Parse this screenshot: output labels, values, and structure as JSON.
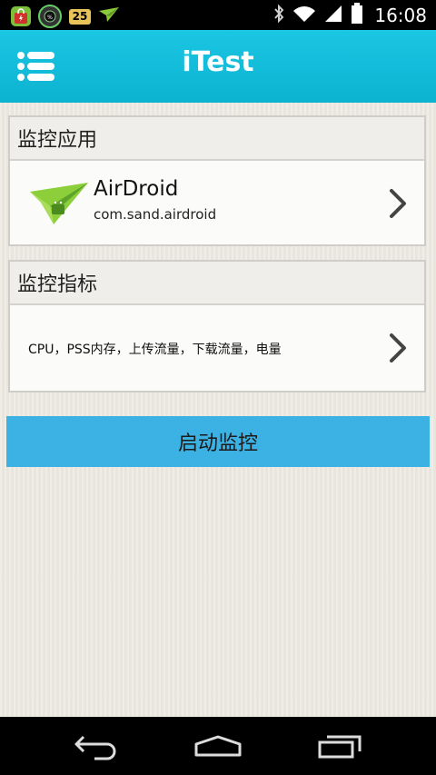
{
  "status_bar": {
    "time": "16:08",
    "notification_badge": "25",
    "icons": [
      "shopping-bag-icon",
      "battery-app-icon",
      "badge-25-icon",
      "airdroid-icon",
      "bluetooth-icon",
      "wifi-icon",
      "signal-icon",
      "battery-icon"
    ]
  },
  "app_bar": {
    "title": "iTest",
    "menu_icon": "menu-icon",
    "background": "#1bc6e3"
  },
  "monitor_app": {
    "header": "监控应用",
    "app_name": "AirDroid",
    "package_name": "com.sand.airdroid",
    "icon": "airdroid-icon"
  },
  "monitor_metrics": {
    "header": "监控指标",
    "metrics": "CPU，PSS内存，上传流量，下载流量，电量"
  },
  "start_button": {
    "label": "启动监控",
    "color": "#3cb1e3"
  },
  "nav_bar": {
    "buttons": [
      "back-icon",
      "home-icon",
      "recents-icon"
    ]
  }
}
